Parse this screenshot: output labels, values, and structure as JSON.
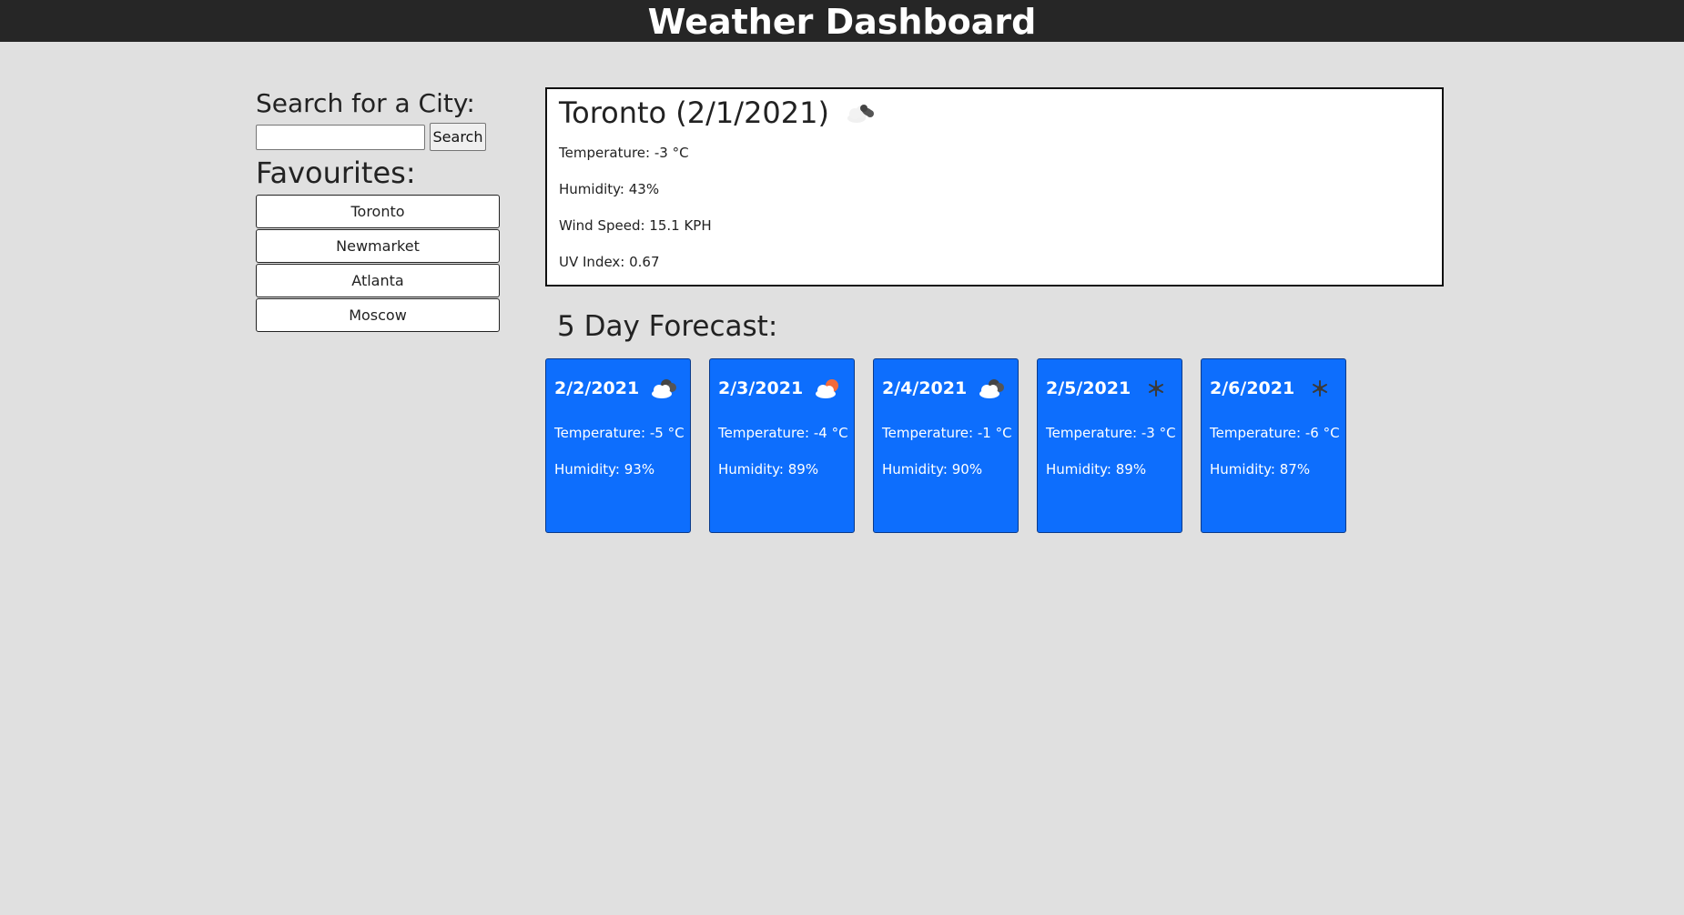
{
  "header": {
    "title": "Weather Dashboard"
  },
  "sidebar": {
    "search_title": "Search for a City:",
    "search_placeholder": "",
    "search_value": "",
    "search_button": "Search",
    "favourites_title": "Favourites:",
    "favourites": [
      {
        "label": "Toronto"
      },
      {
        "label": "Newmarket"
      },
      {
        "label": "Atlanta"
      },
      {
        "label": "Moscow"
      }
    ]
  },
  "current": {
    "title": "Toronto (2/1/2021)",
    "icon": "broken-clouds-icon",
    "temperature": "Temperature: -3 °C",
    "humidity": "Humidity: 43%",
    "wind_speed": "Wind Speed: 15.1 KPH",
    "uv_index": "UV Index: 0.67"
  },
  "forecast": {
    "title": "5 Day Forecast:",
    "days": [
      {
        "date": "2/2/2021",
        "icon": "overcast-clouds-icon",
        "temperature": "Temperature: -5 °C",
        "humidity": "Humidity: 93%"
      },
      {
        "date": "2/3/2021",
        "icon": "partly-cloudy-icon",
        "temperature": "Temperature: -4 °C",
        "humidity": "Humidity: 89%"
      },
      {
        "date": "2/4/2021",
        "icon": "overcast-clouds-icon",
        "temperature": "Temperature: -1 °C",
        "humidity": "Humidity: 90%"
      },
      {
        "date": "2/5/2021",
        "icon": "snow-icon",
        "temperature": "Temperature: -3 °C",
        "humidity": "Humidity: 89%"
      },
      {
        "date": "2/6/2021",
        "icon": "snow-icon",
        "temperature": "Temperature: -6 °C",
        "humidity": "Humidity: 87%"
      }
    ]
  },
  "colors": {
    "header_bg": "#262626",
    "page_bg": "#e0e0e0",
    "card_bg": "#0d6efd"
  }
}
